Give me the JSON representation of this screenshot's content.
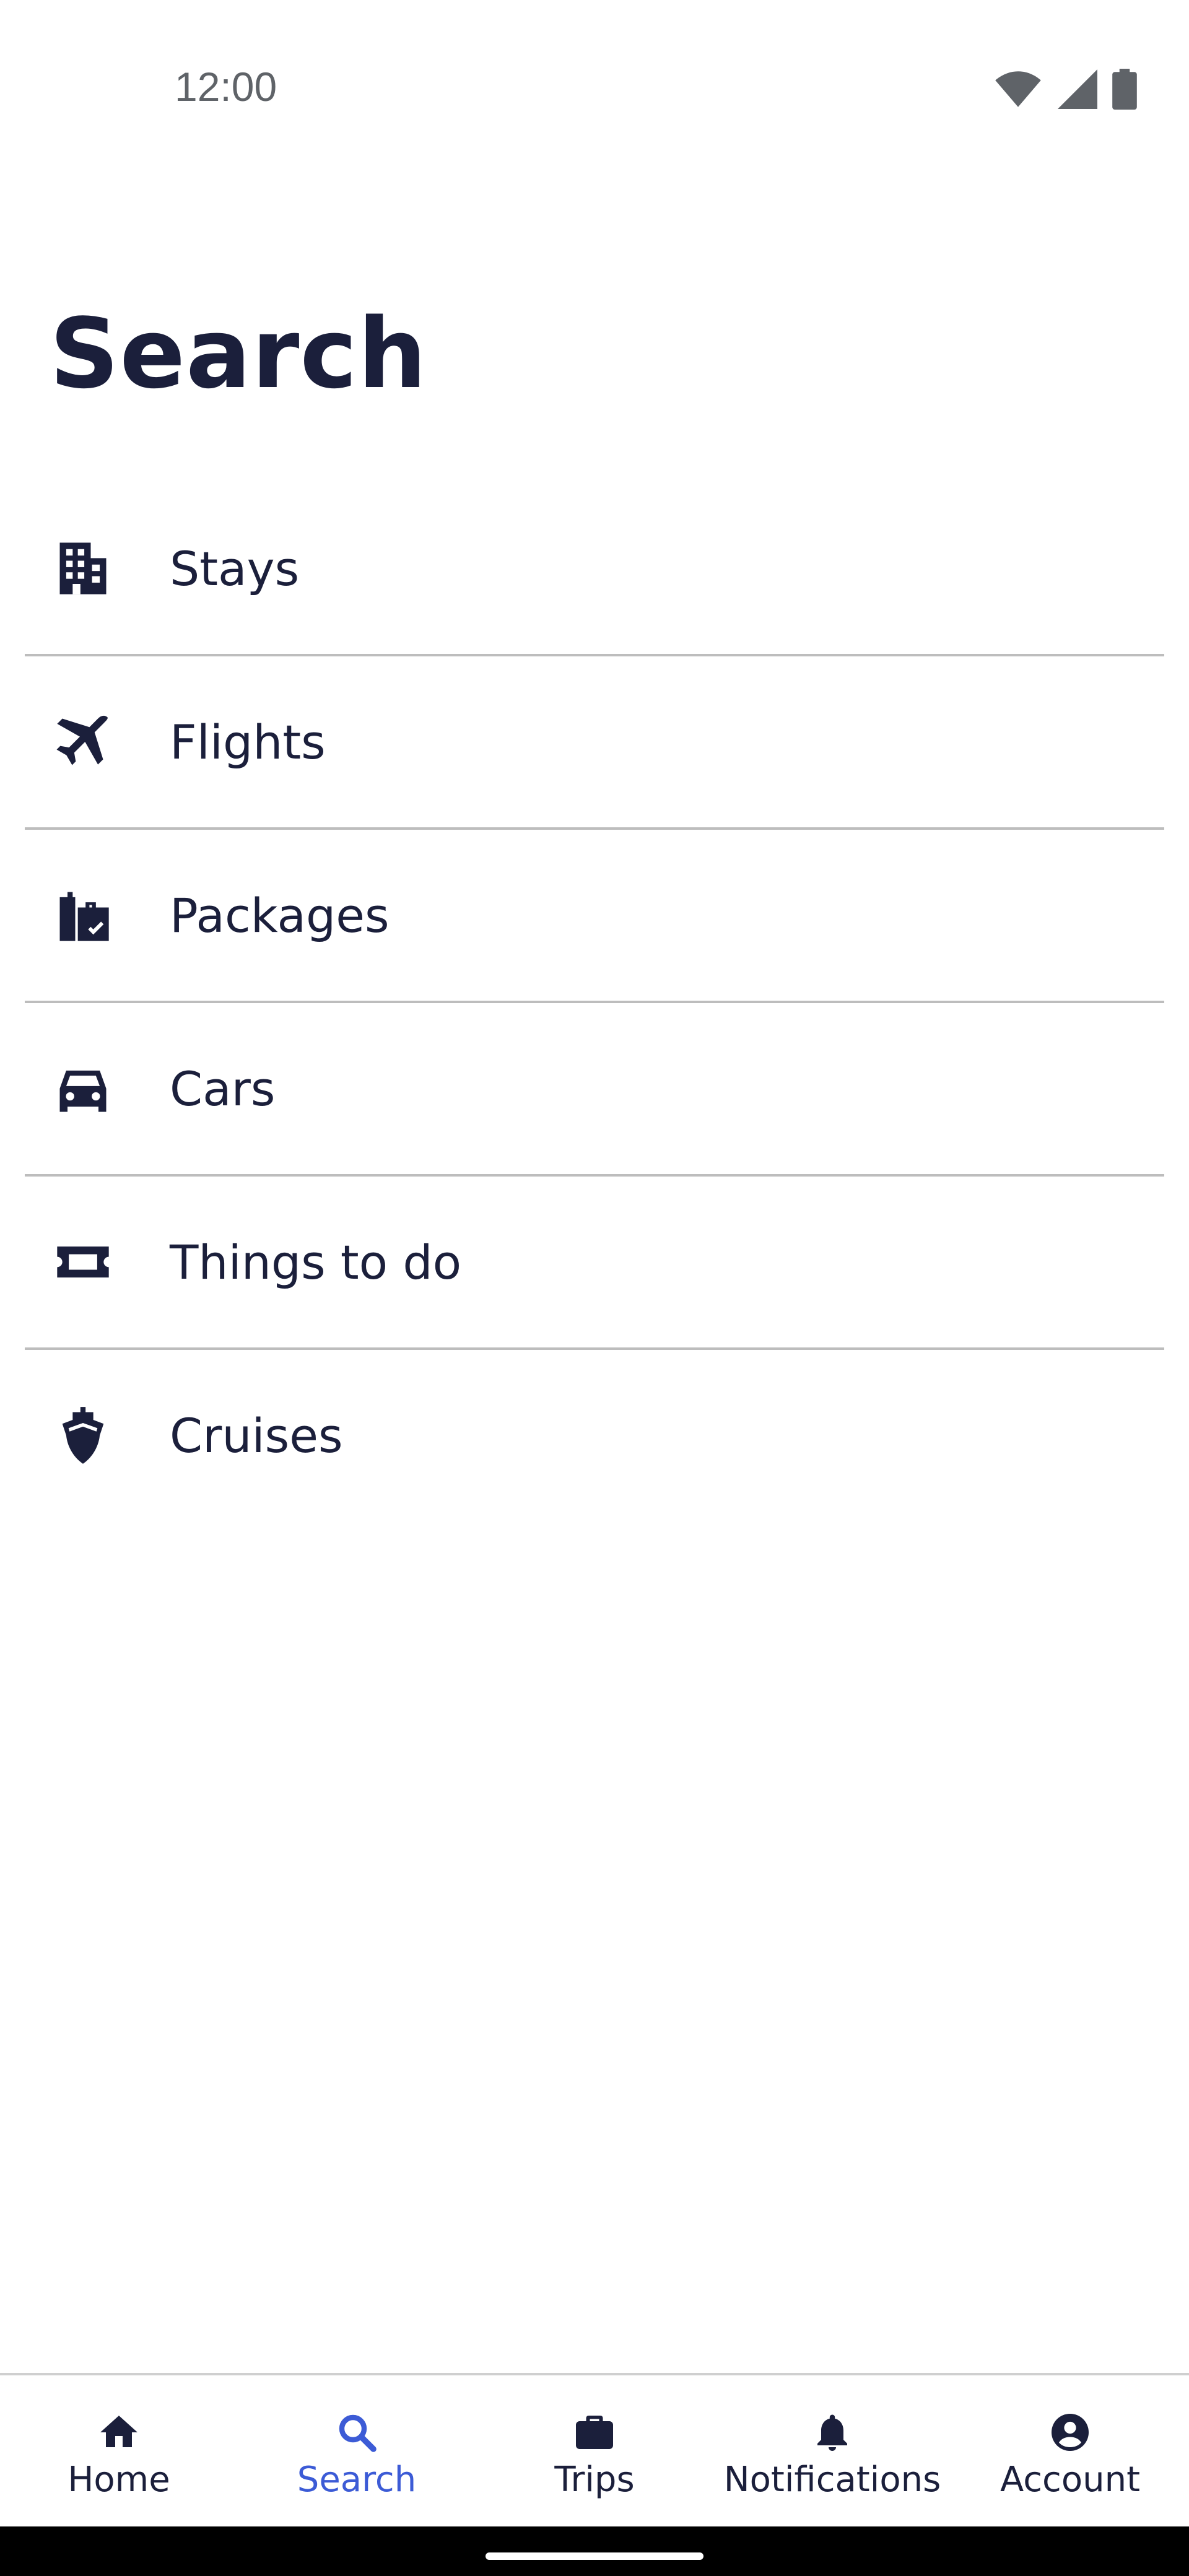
{
  "status_bar": {
    "time": "12:00",
    "icons": [
      "wifi-icon",
      "cellular-signal-icon",
      "battery-icon"
    ]
  },
  "page": {
    "title": "Search"
  },
  "menu": {
    "items": [
      {
        "label": "Stays",
        "icon": "building-icon"
      },
      {
        "label": "Flights",
        "icon": "airplane-icon"
      },
      {
        "label": "Packages",
        "icon": "luggage-icon"
      },
      {
        "label": "Cars",
        "icon": "car-icon"
      },
      {
        "label": "Things to do",
        "icon": "ticket-icon"
      },
      {
        "label": "Cruises",
        "icon": "ship-icon"
      }
    ]
  },
  "bottom_nav": {
    "items": [
      {
        "label": "Home",
        "icon": "home-icon",
        "active": false
      },
      {
        "label": "Search",
        "icon": "search-icon",
        "active": true
      },
      {
        "label": "Trips",
        "icon": "briefcase-icon",
        "active": false
      },
      {
        "label": "Notifications",
        "icon": "bell-icon",
        "active": false
      },
      {
        "label": "Account",
        "icon": "account-icon",
        "active": false
      }
    ]
  },
  "colors": {
    "text_primary": "#1b1f3b",
    "accent": "#3c5bd6",
    "divider": "#bdbdbd",
    "status_text": "#5f6368"
  }
}
